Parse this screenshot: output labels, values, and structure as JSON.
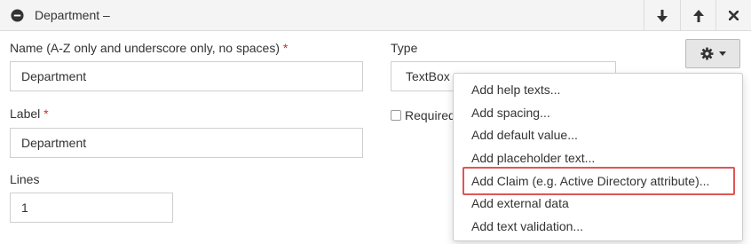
{
  "panel": {
    "title": "Department –",
    "buttons": [
      "move-down",
      "move-up",
      "remove"
    ]
  },
  "fields": {
    "name": {
      "label": "Name (A-Z only and underscore only, no spaces)",
      "required_mark": "*",
      "value": "Department"
    },
    "type": {
      "label": "Type",
      "value": "TextBox"
    },
    "label": {
      "label": "Label",
      "required_mark": "*",
      "value": "Department"
    },
    "required": {
      "label": "Required",
      "checked": false
    },
    "lines": {
      "label": "Lines",
      "value": "1"
    }
  },
  "menu": {
    "icon": "gear-icon",
    "items": [
      "Add help texts...",
      "Add spacing...",
      "Add default value...",
      "Add placeholder text...",
      "Add Claim (e.g. Active Directory attribute)...",
      "Add external data",
      "Add text validation..."
    ],
    "highlighted_index": 4,
    "highlight_color": "#e05555"
  }
}
